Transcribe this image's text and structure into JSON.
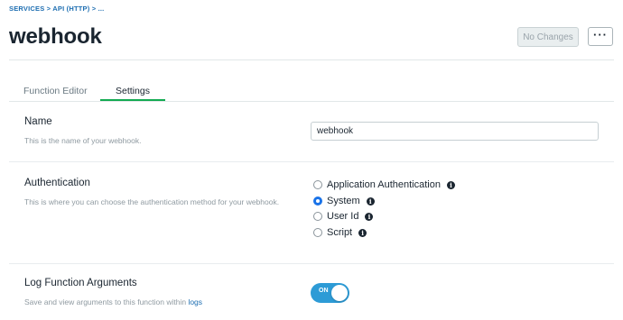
{
  "breadcrumb": "SERVICES > API (HTTP) > ...",
  "page": {
    "title": "webhook"
  },
  "header": {
    "no_changes_label": "No Changes",
    "more_label": "···"
  },
  "tabs": [
    {
      "label": "Function Editor",
      "active": false
    },
    {
      "label": "Settings",
      "active": true
    }
  ],
  "settings": {
    "name": {
      "title": "Name",
      "description": "This is the name of your webhook.",
      "value": "webhook"
    },
    "authentication": {
      "title": "Authentication",
      "description": "This is where you can choose the authentication method for your webhook.",
      "options": [
        {
          "label": "Application Authentication",
          "checked": false,
          "icon": "info-icon"
        },
        {
          "label": "System",
          "checked": true,
          "icon": "info-icon"
        },
        {
          "label": "User Id",
          "checked": false,
          "icon": "info-icon"
        },
        {
          "label": "Script",
          "checked": false,
          "icon": "info-icon"
        }
      ]
    },
    "log_arguments": {
      "title": "Log Function Arguments",
      "description_prefix": "Save and view arguments to this function within ",
      "description_link": "logs",
      "toggle_label": "ON",
      "enabled": true
    }
  },
  "colors": {
    "accent_tab": "#13aa52",
    "link": "#1f6fb2",
    "toggle_on": "#2d9bd6",
    "radio_checked": "#1a73e8"
  }
}
